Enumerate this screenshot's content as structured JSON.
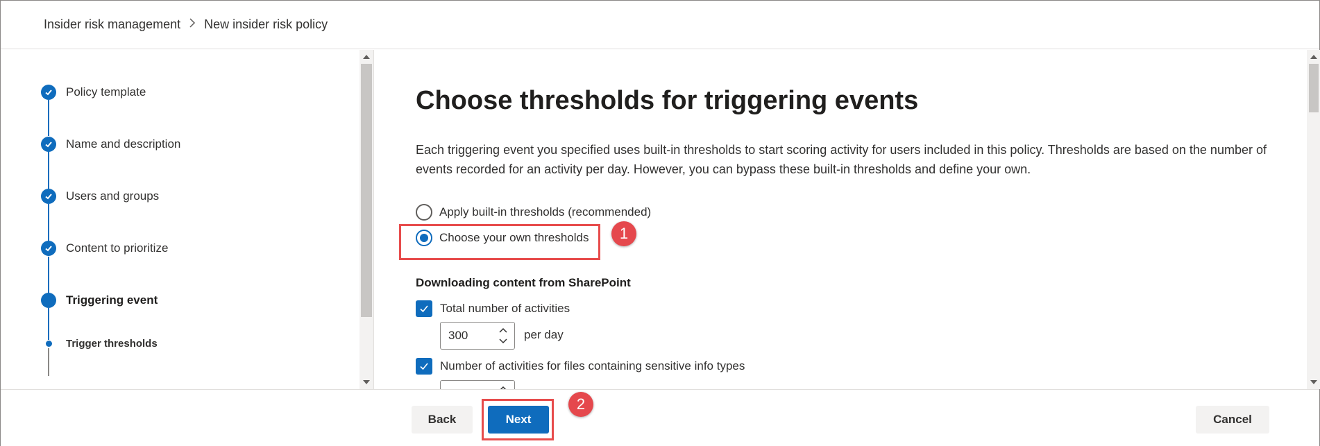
{
  "breadcrumb": {
    "items": [
      "Insider risk management",
      "New insider risk policy"
    ],
    "separator": ">"
  },
  "steps": [
    {
      "label": "Policy template",
      "state": "complete"
    },
    {
      "label": "Name and description",
      "state": "complete"
    },
    {
      "label": "Users and groups",
      "state": "complete"
    },
    {
      "label": "Content to prioritize",
      "state": "complete"
    },
    {
      "label": "Triggering event",
      "state": "current"
    },
    {
      "label": "Trigger thresholds",
      "state": "current-substep"
    }
  ],
  "main": {
    "title": "Choose thresholds for triggering events",
    "description": "Each triggering event you specified uses built-in thresholds to start scoring activity for users included in this policy. Thresholds are based on the number of events recorded for an activity per day. However, you can bypass these built-in thresholds and define your own.",
    "threshold_options": [
      {
        "label": "Apply built-in thresholds (recommended)",
        "selected": false
      },
      {
        "label": "Choose your own thresholds",
        "selected": true
      }
    ],
    "section": {
      "heading": "Downloading content from SharePoint",
      "total_activities": {
        "label": "Total number of activities",
        "checked": true,
        "value": "300",
        "unit": "per day"
      },
      "sensitive_activities": {
        "label": "Number of activities for files containing sensitive info types",
        "checked": true
      }
    }
  },
  "callouts": {
    "one": "1",
    "two": "2"
  },
  "footer": {
    "back_label": "Back",
    "next_label": "Next",
    "cancel_label": "Cancel"
  },
  "colors": {
    "accent": "#0f6cbd",
    "callout": "#e5484d"
  },
  "icons": {
    "step_complete": "checkmark-icon",
    "spin_up": "chevron-up-icon",
    "spin_down": "chevron-down-icon",
    "breadcrumb_separator": "chevron-right-icon"
  }
}
